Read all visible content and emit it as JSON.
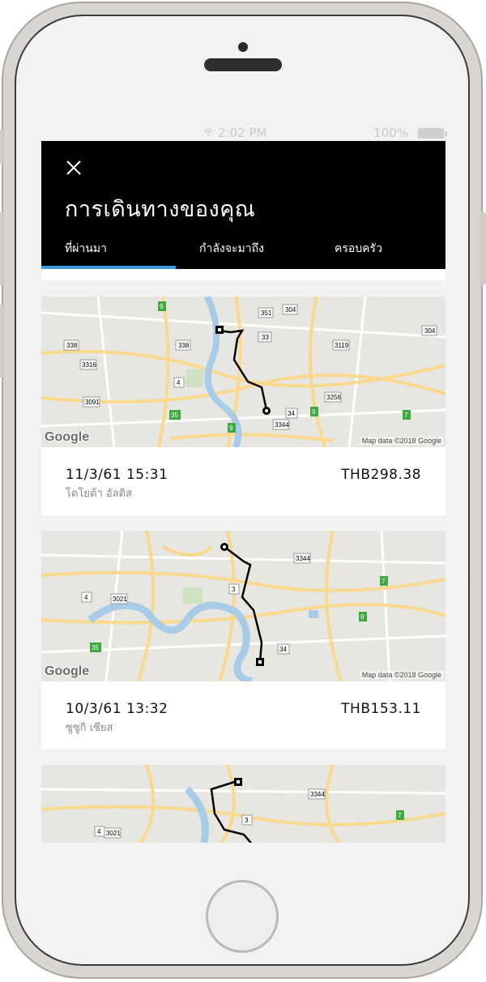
{
  "status": {
    "time": "2:02 PM",
    "battery": "100%"
  },
  "header": {
    "title": "การเดินทางของคุณ"
  },
  "tabs": [
    {
      "label": "ที่ผ่านมา",
      "active": true
    },
    {
      "label": "กำลังจะมาถึง",
      "active": false
    },
    {
      "label": "ครอบครัว",
      "active": false
    }
  ],
  "trips": [
    {
      "date": "11/3/61 15:31",
      "driver": "โตโยต้า อัลติส",
      "fare": "THB298.38",
      "map_credit": "Map data ©2018 Google",
      "map_logo": "Google"
    },
    {
      "date": "10/3/61 13:32",
      "driver": "ซูซูกิ เซียส",
      "fare": "THB153.11",
      "map_credit": "Map data ©2018 Google",
      "map_logo": "Google"
    }
  ],
  "colors": {
    "header_bg": "#000000",
    "accent": "#3a9ad9",
    "route": "#000000",
    "map_bg": "#e8e6e1",
    "road": "#f8d98e",
    "water": "#a8cbe8",
    "park": "#cfe3c4"
  },
  "icons": [
    "close-icon",
    "wifi-icon",
    "battery-icon",
    "route-start-icon",
    "route-end-icon",
    "road-shield-icon"
  ]
}
